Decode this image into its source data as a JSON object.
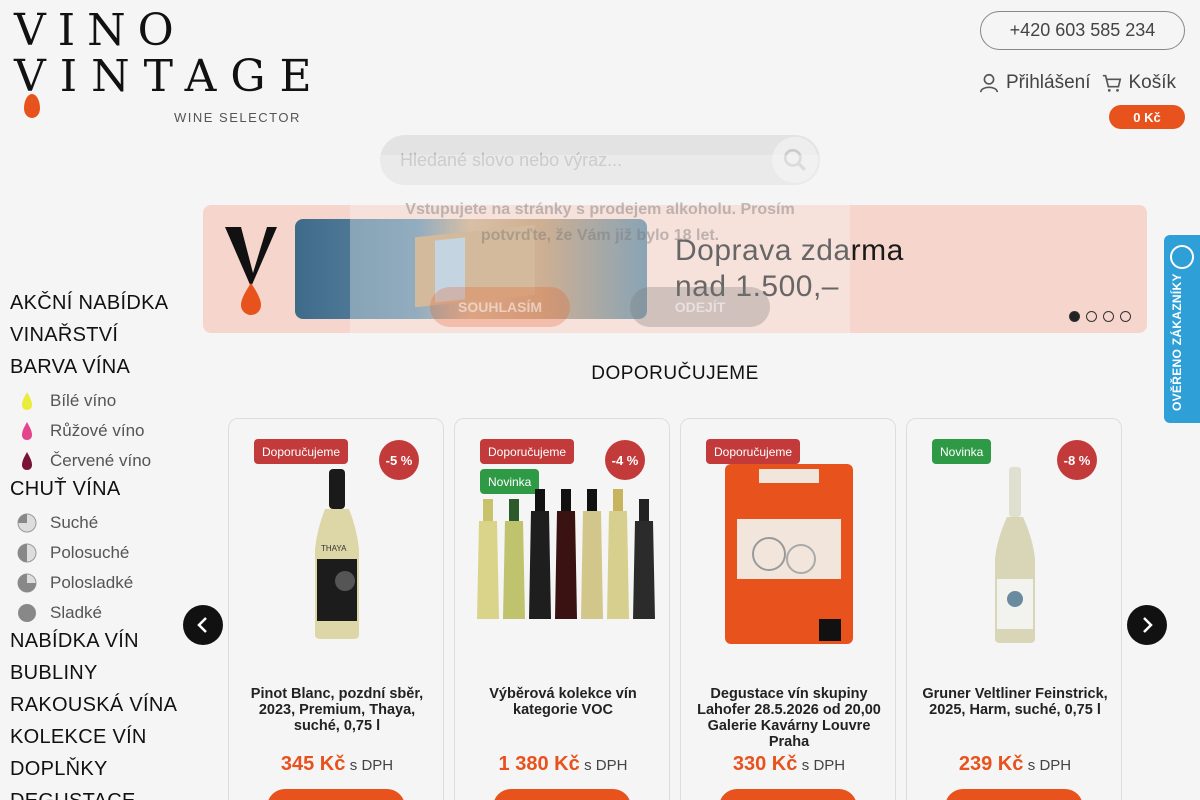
{
  "logo": {
    "line1": "VINO",
    "line2": "VINTAGE",
    "tagline": "WINE SELECTOR"
  },
  "header": {
    "phone": "+420 603 585 234",
    "login_label": "Přihlášení",
    "cart_label": "Košík",
    "cart_total": "0 Kč"
  },
  "search": {
    "placeholder": "Hledané slovo nebo výraz..."
  },
  "age_gate": {
    "text": "Vstupujete na stránky s prodejem alkoholu. Prosím potvrďte, že Vám již bylo 18 let.",
    "agree": "SOUHLASÍM",
    "leave": "ODEJÍT"
  },
  "banner": {
    "title_line1": "Doprava zdarma",
    "title_line2": "nad 1.500,–",
    "slides": 4,
    "active_slide": 1
  },
  "sidebar": {
    "akcni": "AKČNÍ NABÍDKA",
    "vinarstvi": "VINAŘSTVÍ",
    "barva": "BARVA VÍNA",
    "barva_items": [
      "Bílé víno",
      "Růžové víno",
      "Červené víno"
    ],
    "chut": "CHUŤ VÍNA",
    "chut_items": [
      "Suché",
      "Polosuché",
      "Polosladké",
      "Sladké"
    ],
    "nabidka": "NABÍDKA VÍN",
    "bubliny": "BUBLINY",
    "rakouska": "RAKOUSKÁ VÍNA",
    "kolekce": "KOLEKCE VÍN",
    "doplnky": "DOPLŇKY",
    "degustace": "DEGUSTACE"
  },
  "colors": {
    "accent": "#e8521c",
    "tag_recommended": "#c33a3a",
    "tag_new": "#2f9a45",
    "verified": "#2f9fd8"
  },
  "verified_badge": "OVĚŘENO ZÁKAZNÍKY",
  "section_title": "DOPORUČUJEME",
  "products": [
    {
      "tags": [
        "Doporučujeme"
      ],
      "discount": "-5 %",
      "name": "Pinot Blanc, pozdní sběr, 2023, Premium, Thaya, suché, 0,75 l",
      "price": "345 Kč",
      "vat": "s DPH"
    },
    {
      "tags": [
        "Doporučujeme",
        "Novinka"
      ],
      "discount": "-4 %",
      "name": "Výběrová kolekce vín kategorie VOC",
      "price": "1 380 Kč",
      "vat": "s DPH"
    },
    {
      "tags": [
        "Doporučujeme"
      ],
      "discount": "",
      "name": "Degustace vín skupiny Lahofer 28.5.2026 od 20,00 Galerie Kavárny Louvre Praha",
      "price": "330 Kč",
      "vat": "s DPH"
    },
    {
      "tags": [
        "Novinka"
      ],
      "discount": "-8 %",
      "name": "Gruner Veltliner Feinstrick, 2025, Harm, suché, 0,75 l",
      "price": "239 Kč",
      "vat": "s DPH"
    }
  ]
}
